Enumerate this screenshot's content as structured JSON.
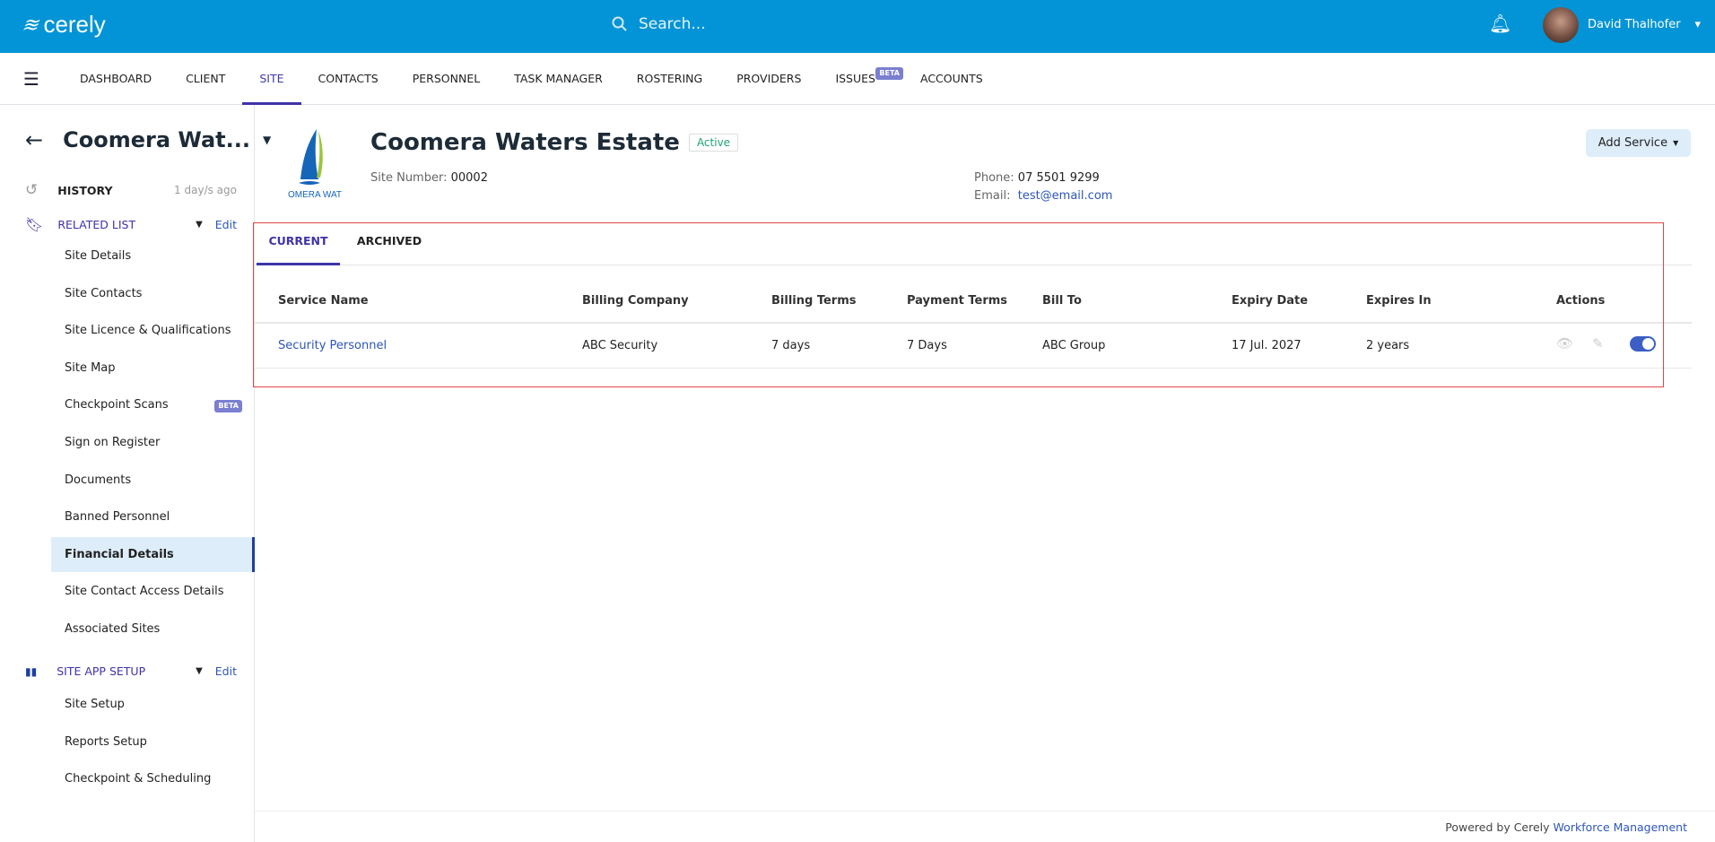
{
  "app": {
    "logo": "cerely",
    "search_placeholder": "Search...",
    "user_name": "David Thalhofer"
  },
  "nav": [
    {
      "label": "DASHBOARD"
    },
    {
      "label": "CLIENT"
    },
    {
      "label": "SITE",
      "active": true
    },
    {
      "label": "CONTACTS"
    },
    {
      "label": "PERSONNEL"
    },
    {
      "label": "TASK MANAGER"
    },
    {
      "label": "ROSTERING"
    },
    {
      "label": "PROVIDERS"
    },
    {
      "label": "ISSUES",
      "badge": "BETA"
    },
    {
      "label": "ACCOUNTS"
    }
  ],
  "sidebar": {
    "title": "Coomera Wat...",
    "history": {
      "label": "HISTORY",
      "time": "1 day/s ago"
    },
    "related": {
      "label": "RELATED LIST",
      "edit": "Edit",
      "items": [
        "Site Details",
        "Site Contacts",
        "Site Licence & Qualifications",
        "Site Map",
        "Checkpoint Scans",
        "Sign on Register",
        "Documents",
        "Banned Personnel",
        "Financial Details",
        "Site Contact Access Details",
        "Associated Sites"
      ],
      "badge": "BETA"
    },
    "setup": {
      "label": "SITE APP SETUP",
      "edit": "Edit",
      "items": [
        "Site Setup",
        "Reports Setup",
        "Checkpoint & Scheduling"
      ]
    }
  },
  "site": {
    "name": "Coomera Waters Estate",
    "status": "Active",
    "logo_text": "COOMERA WATERS",
    "site_number_label": "Site Number:",
    "site_number": "00002",
    "phone_label": "Phone:",
    "phone": "07 5501 9299",
    "email_label": "Email:",
    "email": "test@email.com",
    "add_service": "Add Service"
  },
  "tabs": [
    "CURRENT",
    "ARCHIVED"
  ],
  "table": {
    "headers": [
      "Service Name",
      "Billing Company",
      "Billing Terms",
      "Payment Terms",
      "Bill To",
      "Expiry Date",
      "Expires In",
      "Actions"
    ],
    "rows": [
      [
        "Security Personnel",
        "ABC Security",
        "7 days",
        "7 Days",
        "ABC Group",
        "17 Jul. 2027",
        "2 years"
      ]
    ],
    "toggle_on": true
  },
  "footer": {
    "prefix": "Powered by Cerely",
    "link": "Workforce Management"
  },
  "colors": {
    "header": "#0294d6",
    "accent": "#3f33a8",
    "link": "#2e56b8",
    "highlight": "#e04545"
  }
}
